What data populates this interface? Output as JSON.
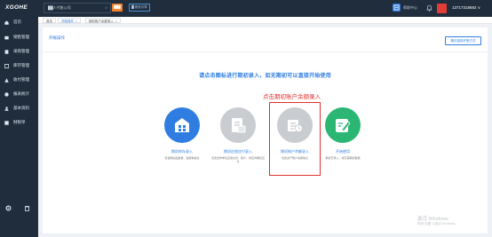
{
  "topbar": {
    "logo": "XGOHE",
    "company": "██人代账公司",
    "orange_button": "███",
    "outline_button": "█ 首页引导",
    "help_text": "帮助中心",
    "user_name": "13717318692 ∨"
  },
  "sidebar": {
    "items": [
      {
        "label": "首页",
        "icon": "home-icon"
      },
      {
        "label": "销售管理",
        "icon": "sales-icon"
      },
      {
        "label": "采购管理",
        "icon": "purchase-icon"
      },
      {
        "label": "库存管理",
        "icon": "inventory-icon"
      },
      {
        "label": "收付管理",
        "icon": "payment-icon"
      },
      {
        "label": "报表统计",
        "icon": "report-icon"
      },
      {
        "label": "基本资料",
        "icon": "profile-icon"
      },
      {
        "label": "财税单",
        "icon": "tax-icon"
      }
    ],
    "bottom_icons": [
      "gear-icon",
      "trash-icon"
    ]
  },
  "tabs": [
    {
      "label": "首页",
      "closable": false
    },
    {
      "label": "开账操作",
      "closable": true
    },
    {
      "label": "期初账户余额录入",
      "closable": true
    }
  ],
  "panel": {
    "title": "开账操作",
    "action_button": "期初选择开账方式"
  },
  "headline": "请点击图标进行期初录入，如无期初可以直接开始使用",
  "annotation": "点击期初账户余额录入",
  "options": [
    {
      "label": "期初库存录入",
      "desc": "包含期初品数量、金额等信息",
      "color": "#2f7de1",
      "icon": "warehouse-icon"
    },
    {
      "label": "期初应收应付录入",
      "desc": "包含合作单位应收欠款、客户、供应商期初应付",
      "color": "#c9ccd1",
      "icon": "document-icon"
    },
    {
      "label": "期初账户余额录入",
      "desc": "包含资产账户余额信息",
      "color": "#c9ccd1",
      "icon": "account-icon"
    },
    {
      "label": "开始使用",
      "desc": "期初已录入，或无需期初数据",
      "color": "#2bb673",
      "icon": "edit-icon"
    }
  ],
  "watermark": {
    "line1": "激活 Windows",
    "line2": "转到“设置”以激活 Windows。"
  }
}
